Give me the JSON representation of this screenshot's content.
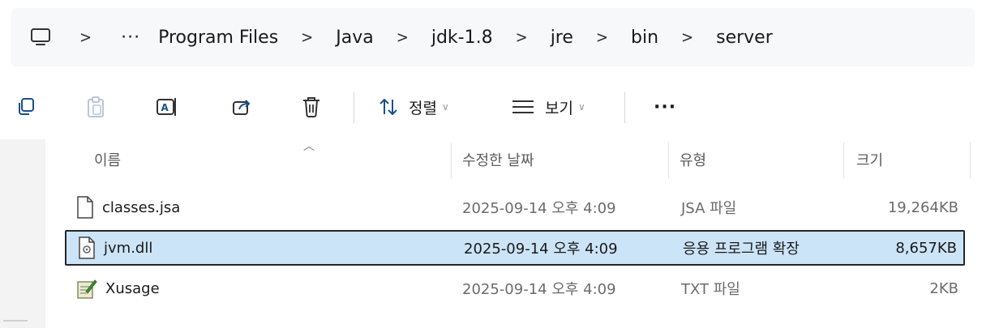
{
  "breadcrumb": {
    "icon": "computer-icon",
    "overflow": "···",
    "items": [
      "Program Files",
      "Java",
      "jdk-1.8",
      "jre",
      "bin",
      "server"
    ],
    "separator": ">"
  },
  "toolbar": {
    "sort_label": "정렬",
    "view_label": "보기",
    "more_label": "···",
    "icons": [
      "copy-icon",
      "paste-icon",
      "rename-icon",
      "share-icon",
      "delete-icon",
      "sort-icon",
      "view-icon"
    ]
  },
  "columns": {
    "name": "이름",
    "date": "수정한 날짜",
    "type": "유형",
    "size": "크기"
  },
  "files": [
    {
      "name": "classes.jsa",
      "date": "2025-09-14 오후 4:09",
      "type": "JSA 파일",
      "size": "19,264KB",
      "icon": "file-icon",
      "selected": false
    },
    {
      "name": "jvm.dll",
      "date": "2025-09-14 오후 4:09",
      "type": "응용 프로그램 확장",
      "size": "8,657KB",
      "icon": "dll-file-icon",
      "selected": true
    },
    {
      "name": "Xusage",
      "date": "2025-09-14 오후 4:09",
      "type": "TXT 파일",
      "size": "2KB",
      "icon": "text-file-icon",
      "selected": false
    }
  ],
  "colors": {
    "selection": "#cce4f7",
    "addressbar": "#f6f8fa"
  }
}
